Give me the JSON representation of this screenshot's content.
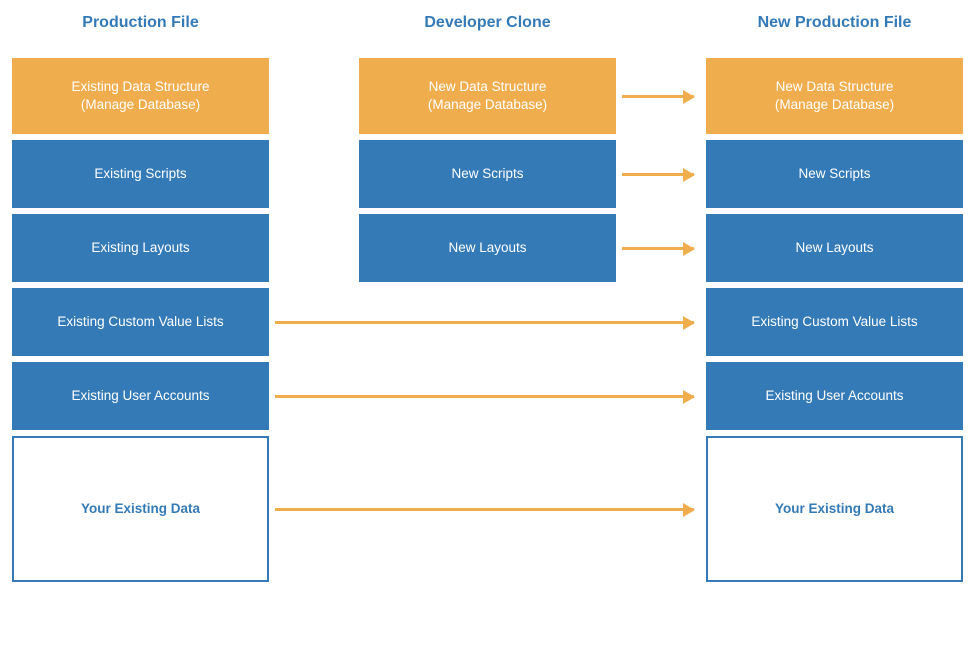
{
  "headers": {
    "production": "Production File",
    "clone": "Developer Clone",
    "newprod": "New Production File"
  },
  "production": {
    "structure_line1": "Existing Data Structure",
    "structure_line2": "(Manage Database)",
    "scripts": "Existing Scripts",
    "layouts": "Existing Layouts",
    "cvl": "Existing Custom Value Lists",
    "accounts": "Existing User Accounts",
    "data": "Your Existing Data"
  },
  "clone": {
    "structure_line1": "New Data Structure",
    "structure_line2": "(Manage Database)",
    "scripts": "New Scripts",
    "layouts": "New Layouts"
  },
  "newprod": {
    "structure_line1": "New Data Structure",
    "structure_line2": "(Manage Database)",
    "scripts": "New Scripts",
    "layouts": "New Layouts",
    "cvl": "Existing Custom Value Lists",
    "accounts": "Existing User Accounts",
    "data": "Your Existing Data"
  },
  "colors": {
    "blue": "#337ab7",
    "orange": "#f0ad4e"
  }
}
